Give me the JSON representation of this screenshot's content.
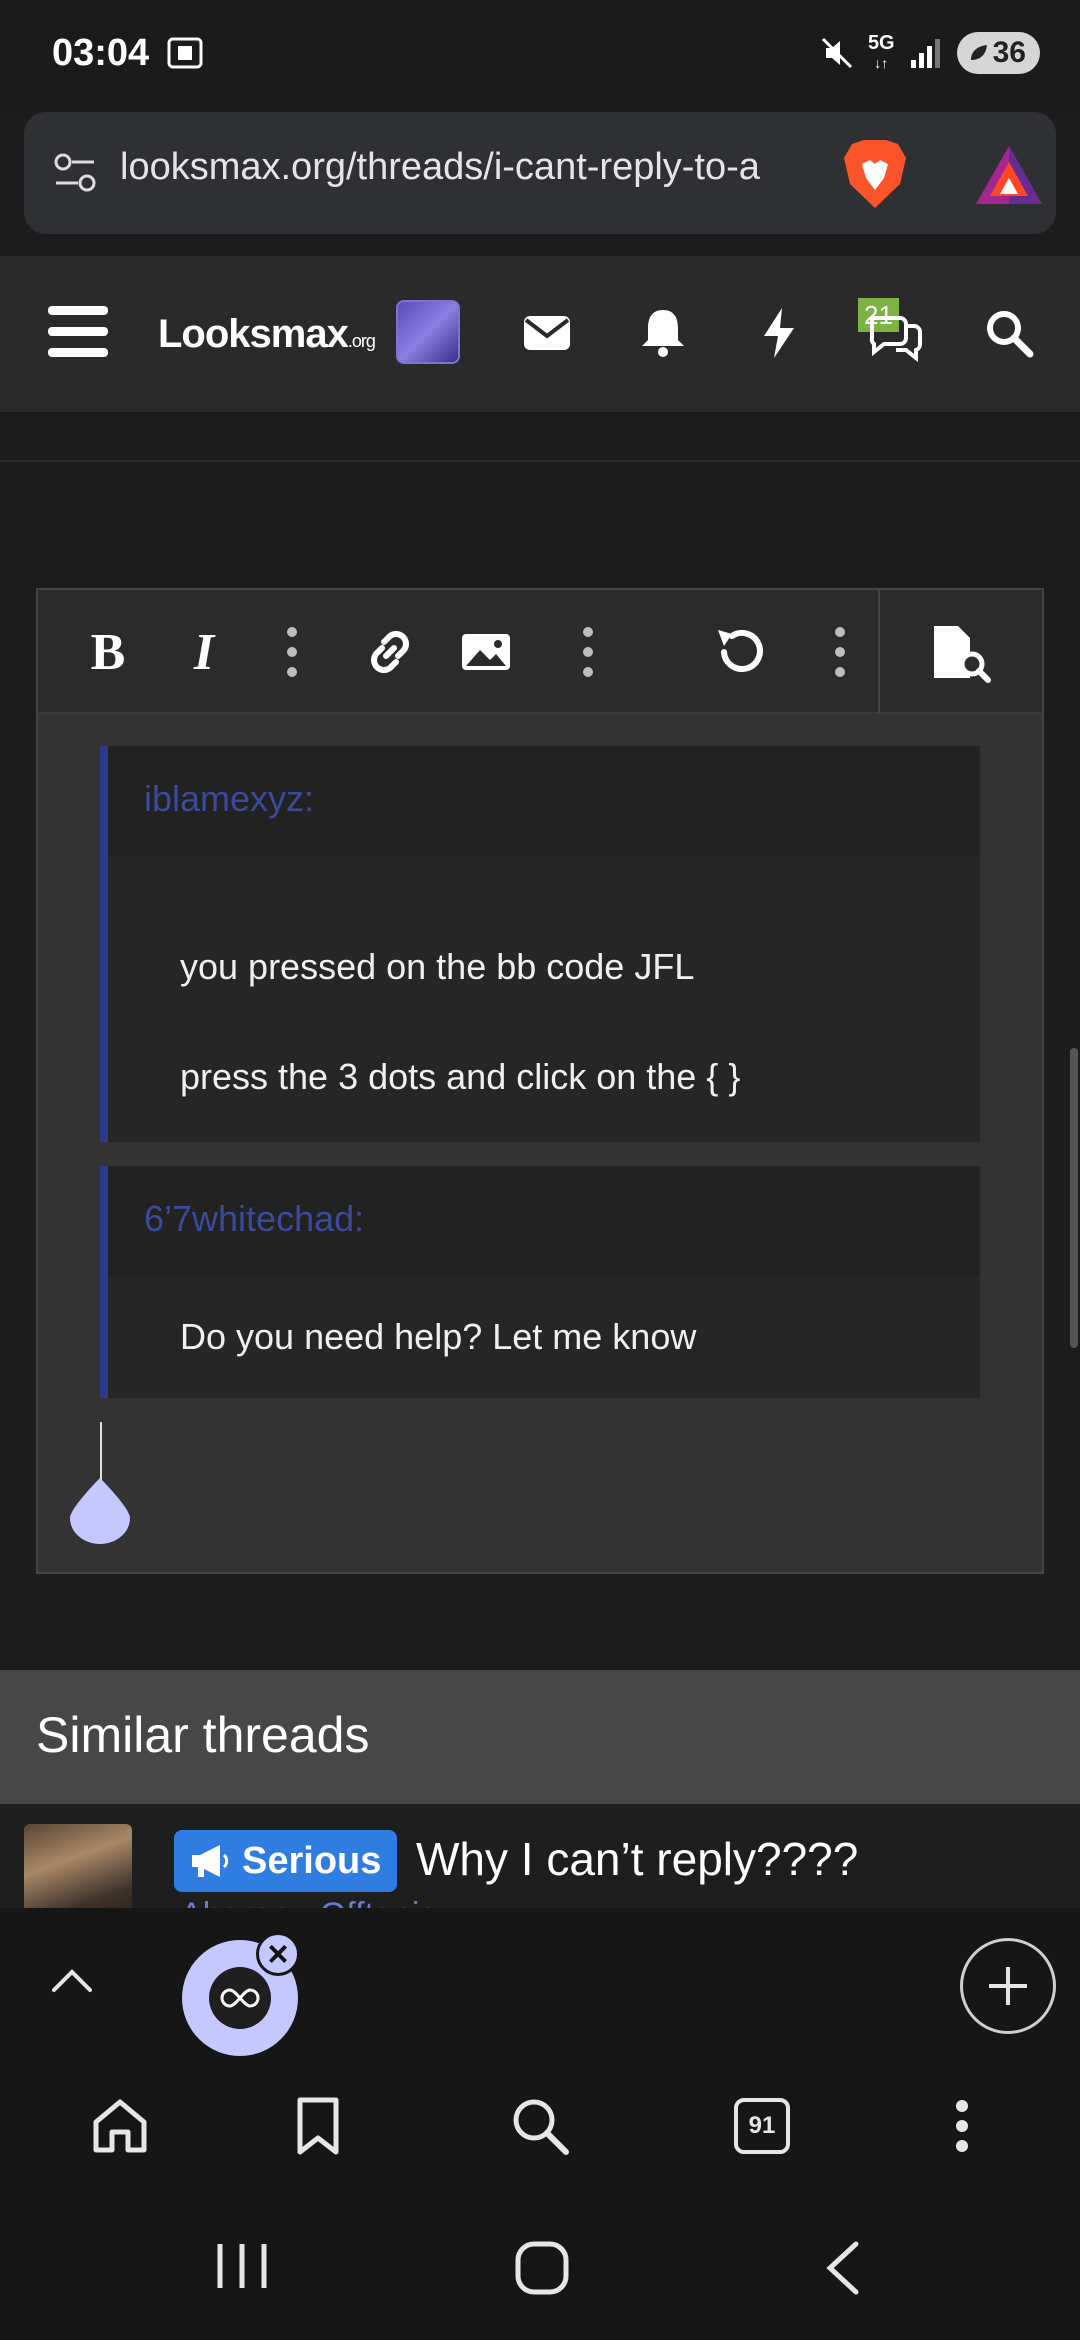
{
  "status_bar": {
    "time": "03:04",
    "network": "5G",
    "battery": "36"
  },
  "url_bar": {
    "url": "looksmax.org/threads/i-cant-reply-to-a",
    "icons": [
      "tune-icon",
      "brave-lion-icon",
      "brave-rewards-icon"
    ]
  },
  "site_header": {
    "logo": "Looksmax",
    "logo_suffix": ".org",
    "notification_count": "21",
    "icons": [
      "menu-icon",
      "avatar",
      "mail-icon",
      "bell-icon",
      "lightning-icon",
      "chat-icon",
      "search-icon"
    ]
  },
  "editor": {
    "toolbar": [
      "bold-icon",
      "italic-icon",
      "more-text-icon",
      "link-icon",
      "image-icon",
      "more-insert-icon",
      "undo-icon",
      "more-options-icon",
      "preview-icon"
    ],
    "quotes": [
      {
        "author": "iblamexyz:",
        "lines": [
          "you pressed on the bb code JFL",
          "press the 3 dots and click on the { }"
        ]
      },
      {
        "author": "6’7whitechad:",
        "lines": [
          "Do you need help? Let me know"
        ]
      }
    ]
  },
  "similar_threads": {
    "heading": "Similar threads",
    "items": [
      {
        "tag": "Serious",
        "title": "Why I can’t reply????",
        "meta": "Aharon · Offtopic"
      }
    ]
  },
  "browser_bar": {
    "tab_count": "91"
  },
  "colors": {
    "accent_blue": "#2f7de1",
    "quote_author": "#3b4a9a",
    "badge_green": "#7cb342",
    "tab_circle": "#c5c7ff"
  }
}
